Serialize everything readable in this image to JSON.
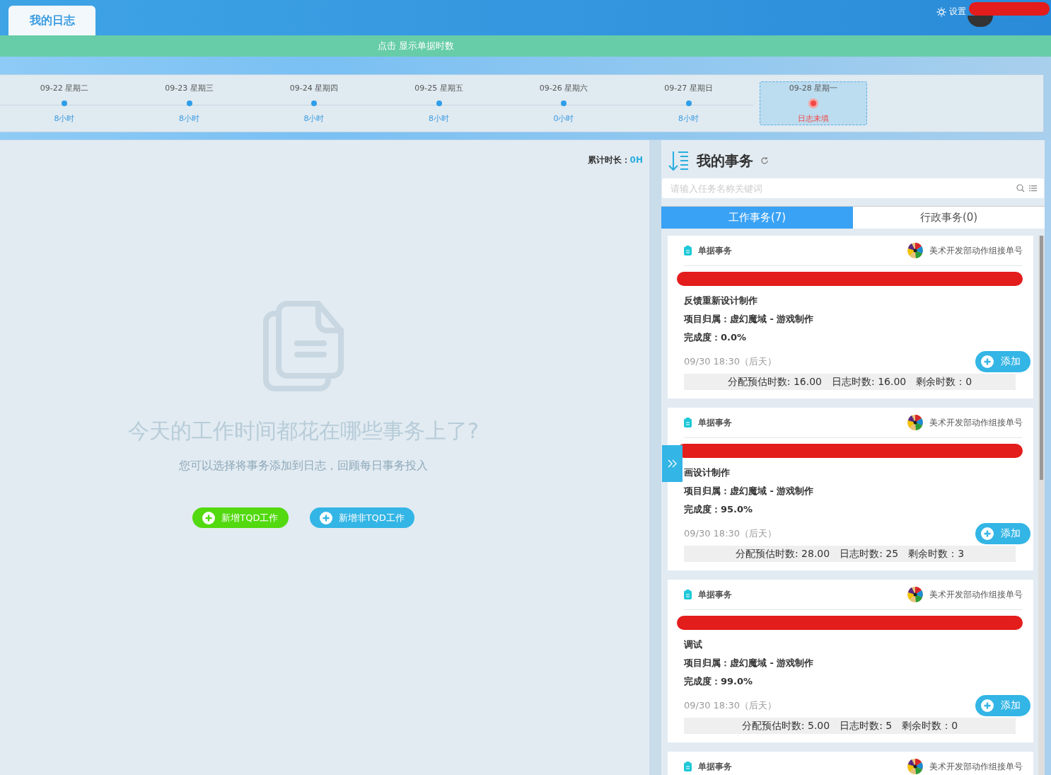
{
  "header": {
    "tab": "我的日志",
    "settings": "设置"
  },
  "banner": "点击 显示单据时数",
  "days": [
    {
      "date": "09-22 星期二",
      "hours": "8小时",
      "missing": false,
      "selected": false
    },
    {
      "date": "09-23 星期三",
      "hours": "8小时",
      "missing": false,
      "selected": false
    },
    {
      "date": "09-24 星期四",
      "hours": "8小时",
      "missing": false,
      "selected": false
    },
    {
      "date": "09-25 星期五",
      "hours": "8小时",
      "missing": false,
      "selected": false
    },
    {
      "date": "09-26 星期六",
      "hours": "0小时",
      "missing": false,
      "selected": false
    },
    {
      "date": "09-27 星期日",
      "hours": "8小时",
      "missing": false,
      "selected": false
    },
    {
      "date": "09-28 星期一",
      "hours": "日志未填",
      "missing": true,
      "selected": true
    }
  ],
  "log": {
    "total_label": "累计时长：",
    "total_value": "0H",
    "empty_title": "今天的工作时间都花在哪些事务上了?",
    "empty_hint": "您可以选择将事务添加到日志，回顾每日事务投入",
    "buttons": [
      {
        "label": "新增TQD工作",
        "kind": "tqd"
      },
      {
        "label": "新增非TQD工作",
        "kind": "other"
      }
    ]
  },
  "tasks": {
    "title": "我的事务",
    "search": {
      "placeholder": "请输入任务名称关键词"
    },
    "tabs": [
      {
        "label": "工作事务(7)",
        "selected": true
      },
      {
        "label": "行政事务(0)",
        "selected": false
      }
    ],
    "cards": [
      {
        "category": "单据事务",
        "owner": "美术开发部动作组接单号",
        "title": "反馈重新设计制作",
        "project": "项目归属：虚幻魔域 - 游戏制作",
        "progress": "完成度：0.0%",
        "deadline": "09/30 18:30（后天）",
        "add": "添加",
        "estimate": "分配预估时数: 16.00",
        "logged": "日志时数: 16.00",
        "remaining": "剩余时数：0"
      },
      {
        "category": "单据事务",
        "owner": "美术开发部动作组接单号",
        "title": "画设计制作",
        "project": "项目归属：虚幻魔域 - 游戏制作",
        "progress": "完成度：95.0%",
        "deadline": "09/30 18:30（后天）",
        "add": "添加",
        "estimate": "分配预估时数: 28.00",
        "logged": "日志时数: 25",
        "remaining": "剩余时数：3"
      },
      {
        "category": "单据事务",
        "owner": "美术开发部动作组接单号",
        "title": "调试",
        "project": "项目归属：虚幻魔域 - 游戏制作",
        "progress": "完成度：99.0%",
        "deadline": "09/30 18:30（后天）",
        "add": "添加",
        "estimate": "分配预估时数: 5.00",
        "logged": "日志时数: 5",
        "remaining": "剩余时数：0"
      },
      {
        "category": "单据事务",
        "owner": "美术开发部动作组接单号"
      }
    ]
  }
}
